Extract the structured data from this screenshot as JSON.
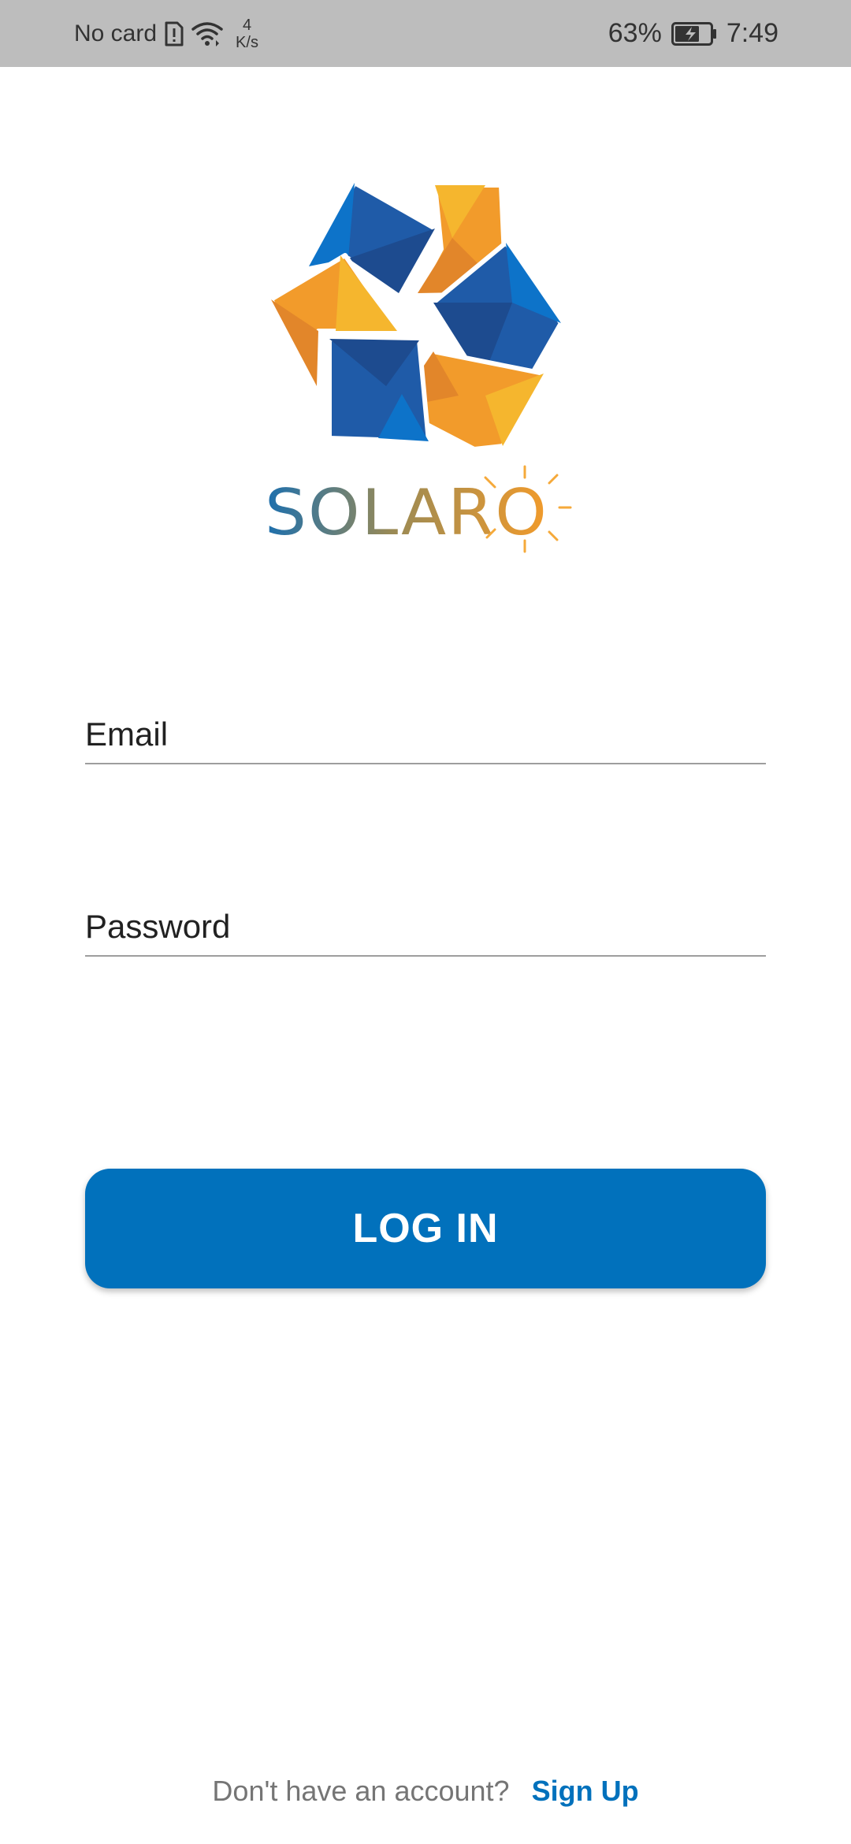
{
  "status_bar": {
    "carrier": "No card",
    "net_speed_value": "4",
    "net_speed_unit": "K/s",
    "battery": "63%",
    "time": "7:49",
    "icons": [
      "sim-alert-icon",
      "wifi-icon",
      "battery-charging-icon"
    ]
  },
  "logo": {
    "wordmark": "SOLARO",
    "icon": "solaro-pinwheel-logo-icon",
    "colors": {
      "blue": "#1f5ba8",
      "blue_dark": "#1d4b8f",
      "blue_light": "#0d73c9",
      "orange": "#f29b2b",
      "orange_dark": "#e2862a",
      "yellow": "#f5b62e"
    }
  },
  "form": {
    "email_placeholder": "Email",
    "password_placeholder": "Password",
    "login_label": "LOG IN"
  },
  "footer": {
    "prompt": "Don't have an account?",
    "signup_label": "Sign Up"
  },
  "colors": {
    "accent": "#0171bc",
    "status_bar_bg": "#bdbdbd",
    "underline": "#9e9e9e"
  }
}
